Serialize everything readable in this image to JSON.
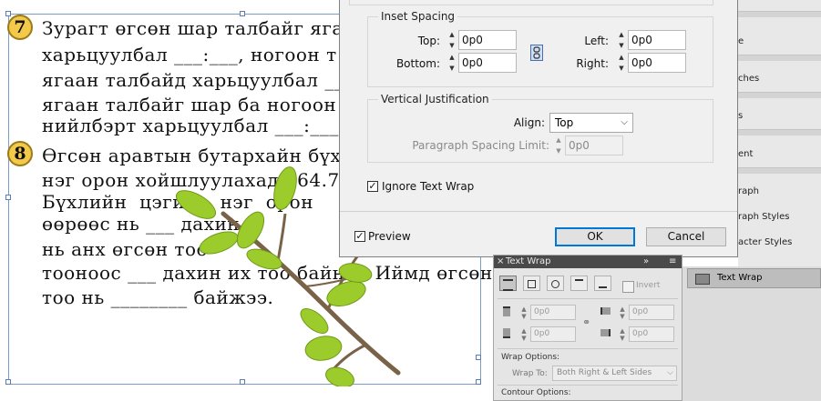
{
  "document": {
    "q7_number": "7",
    "q7_lines": [
      "Зурагт өгсөн шар талбайг ягаа",
      "харьцуулбал ___:___, ногоон т",
      "ягаан талбайд харьцуулбал ___",
      "ягаан талбайг шар ба ногоон т",
      "нийлбэрт харьцуулбал ___:___"
    ],
    "q8_number": "8",
    "q8_lines": [
      "Өгсөн аравтын бутархайн бүхл",
      "нэг орон хойшлуулахад 564.7",
      "Бүхлийн  цэгийг  нэг  орон",
      "өөрөөс нь ___ дахин и",
      "нь анх өгсөн тоо",
      "тооноос ___ дахин их тоо байна.  Иймд өгсөн",
      "тоо нь ________ байжээ."
    ]
  },
  "dialog": {
    "inset_spacing": {
      "title": "Inset Spacing",
      "top_label": "Top:",
      "top_value": "0p0",
      "bottom_label": "Bottom:",
      "bottom_value": "0p0",
      "left_label": "Left:",
      "left_value": "0p0",
      "right_label": "Right:",
      "right_value": "0p0"
    },
    "vertical_justification": {
      "title": "Vertical Justification",
      "align_label": "Align:",
      "align_value": "Top",
      "spacing_label": "Paragraph Spacing Limit:",
      "spacing_value": "0p0"
    },
    "ignore_text_wrap": {
      "label": "Ignore Text Wrap",
      "checked": true
    },
    "preview": {
      "label": "Preview",
      "checked": true
    },
    "ok_label": "OK",
    "cancel_label": "Cancel"
  },
  "right_panels": {
    "items": [
      "e",
      "ches",
      "s",
      "ent",
      "raph",
      "raph Styles",
      "acter Styles"
    ],
    "text_wrap_tab": "Text Wrap"
  },
  "text_wrap_panel": {
    "title": "Text Wrap",
    "invert_label": "Invert",
    "offset_values": [
      "0p0",
      "0p0",
      "0p0",
      "0p0"
    ],
    "wrap_options_label": "Wrap Options:",
    "wrap_to_label": "Wrap To:",
    "wrap_to_value": "Both Right & Left Sides",
    "contour_options_label": "Contour Options:"
  },
  "colors": {
    "dialog_bg": "#f0f0f0",
    "accent": "#0078d7",
    "number_badge": "#f3c94a",
    "leaf_green": "#9ccc2c",
    "branch": "#7a6248"
  }
}
